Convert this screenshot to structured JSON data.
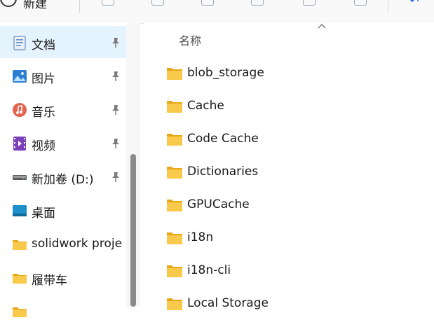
{
  "toolbar": {
    "new_label": "新建",
    "icons": [
      "cut-icon",
      "copy-icon",
      "paste-icon",
      "rename-icon",
      "share-icon",
      "delete-icon",
      "sort-icon"
    ]
  },
  "sidebar": {
    "items": [
      {
        "label": "文档",
        "icon": "documents-icon",
        "pinned": true,
        "selected": true
      },
      {
        "label": "图片",
        "icon": "pictures-icon",
        "pinned": true
      },
      {
        "label": "音乐",
        "icon": "music-icon",
        "pinned": true
      },
      {
        "label": "视频",
        "icon": "videos-icon",
        "pinned": true
      },
      {
        "label": "新加卷 (D:)",
        "icon": "drive-icon",
        "pinned": true
      },
      {
        "label": "桌面",
        "icon": "desktop-icon",
        "pinned": false
      },
      {
        "label": "solidwork proje",
        "icon": "folder-icon",
        "pinned": false
      },
      {
        "label": "履带车",
        "icon": "folder-icon",
        "pinned": false
      },
      {
        "label": "",
        "icon": "folder-icon",
        "pinned": false
      }
    ]
  },
  "main": {
    "column_header": "名称",
    "files": [
      {
        "name": "blob_storage"
      },
      {
        "name": "Cache"
      },
      {
        "name": "Code Cache"
      },
      {
        "name": "Dictionaries"
      },
      {
        "name": "GPUCache"
      },
      {
        "name": "i18n"
      },
      {
        "name": "i18n-cli"
      },
      {
        "name": "Local Storage"
      }
    ]
  },
  "colors": {
    "selected_bg": "#e5f3ff",
    "folder_yellow": "#f8c94a",
    "folder_dark": "#e6a817",
    "scroll_thumb": "#8a8a8a"
  }
}
